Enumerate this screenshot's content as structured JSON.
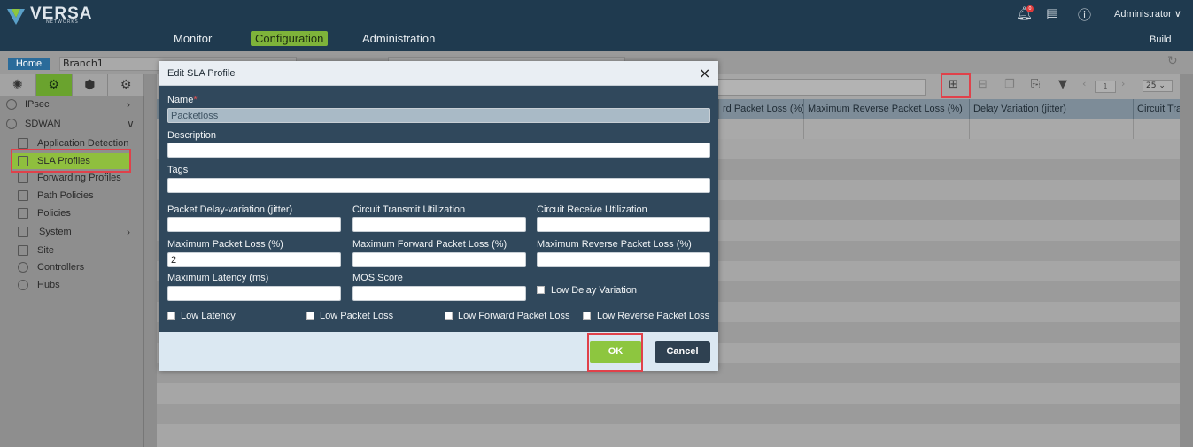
{
  "app": {
    "brand": "VERSA",
    "brand_sub": "NETWORKS",
    "notification_count": "0",
    "user": "Administrator",
    "user_caret": "∨",
    "build": "Build"
  },
  "nav": {
    "monitor": "Monitor",
    "configuration": "Configuration",
    "administration": "Administration"
  },
  "breadcrumb": {
    "home": "Home",
    "appliance": "Branch1"
  },
  "sidebar": {
    "tabs": [
      "network-icon",
      "gear-icon",
      "cube-icon",
      "settings-gear-icon"
    ],
    "items": [
      {
        "label": "IPsec",
        "icon": "ipsec-icon",
        "caret": "›"
      },
      {
        "label": "SDWAN",
        "icon": "sdwan-icon",
        "caret": "∨"
      },
      {
        "label": "Application Detection",
        "icon": "doc-icon"
      },
      {
        "label": "SLA Profiles",
        "icon": "doc-icon"
      },
      {
        "label": "Forwarding Profiles",
        "icon": "doc-icon"
      },
      {
        "label": "Path Policies",
        "icon": "policy-icon"
      },
      {
        "label": "Policies",
        "icon": "policy-icon"
      },
      {
        "label": "System",
        "icon": "folder-icon",
        "caret": "›"
      },
      {
        "label": "Site",
        "icon": "site-icon"
      },
      {
        "label": "Controllers",
        "icon": "controller-icon"
      },
      {
        "label": "Hubs",
        "icon": "hub-icon"
      }
    ]
  },
  "grid": {
    "columns": [
      "rd Packet Loss (%)",
      "Maximum Reverse Packet Loss (%)",
      "Delay Variation (jitter)",
      "Circuit Tra"
    ],
    "page": "1",
    "page_size": "25"
  },
  "modal": {
    "title": "Edit SLA Profile",
    "close": "×",
    "name_label": "Name",
    "required_mark": "*",
    "name_value": "Packetloss",
    "description_label": "Description",
    "tags_label": "Tags",
    "jitter_label": "Packet Delay-variation (jitter)",
    "circuit_tx_label": "Circuit Transmit Utilization",
    "circuit_rx_label": "Circuit Receive Utilization",
    "max_loss_label": "Maximum Packet Loss (%)",
    "max_loss_value": "2",
    "max_fwd_loss_label": "Maximum Forward Packet Loss (%)",
    "max_rev_loss_label": "Maximum Reverse Packet Loss (%)",
    "max_latency_label": "Maximum Latency (ms)",
    "mos_label": "MOS Score",
    "low_delay_variation": "Low Delay Variation",
    "low_latency": "Low Latency",
    "low_packet_loss": "Low Packet Loss",
    "low_forward_loss": "Low Forward Packet Loss",
    "low_reverse_loss": "Low Reverse Packet Loss",
    "ok": "OK",
    "cancel": "Cancel"
  },
  "colors": {
    "accent_green": "#8dc63f",
    "header_navy": "#1f3a4f",
    "modal_body": "#30485c",
    "highlight_red": "#e0414a"
  }
}
